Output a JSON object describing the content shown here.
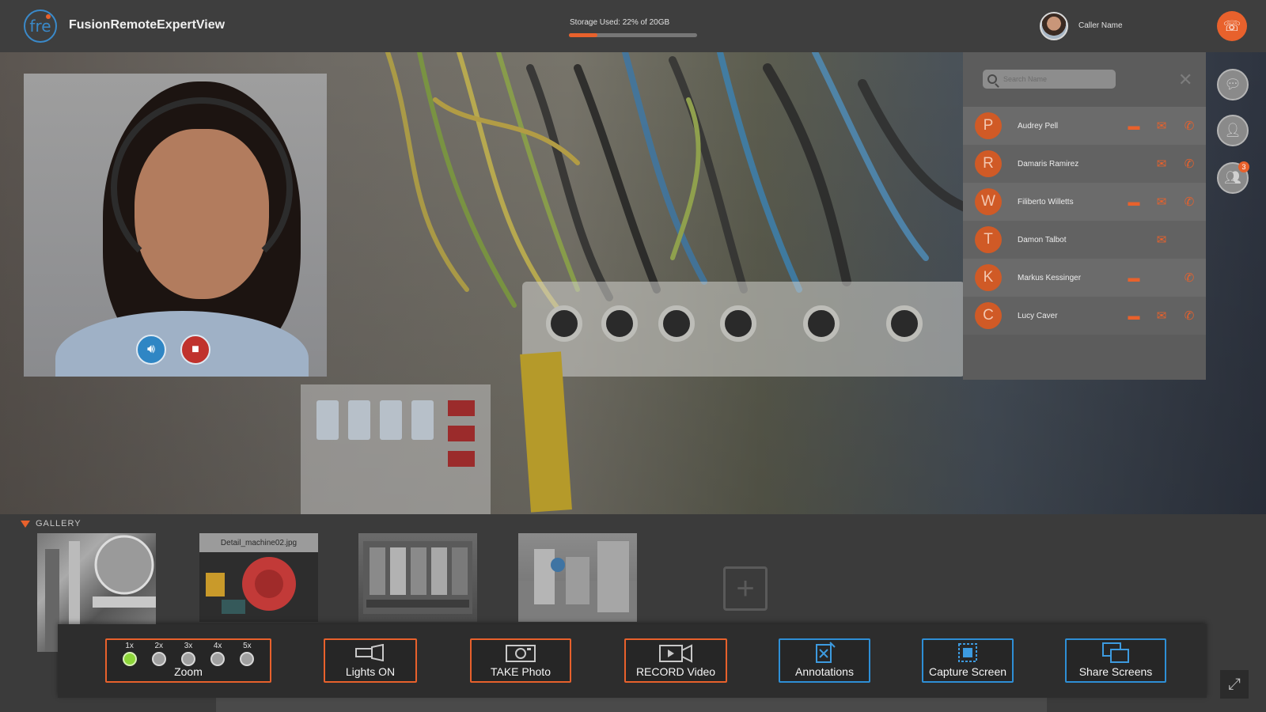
{
  "header": {
    "app_title": "FusionRemoteExpertView",
    "logo_text": "fre",
    "storage_label": "Storage Used: 22% of 20GB",
    "storage_fraction": 0.22,
    "caller_name": "Caller Name",
    "end_call_icon": "phone-hangup-icon"
  },
  "self_view": {
    "audio_icon": "speaker-icon",
    "video_icon": "video-off-icon"
  },
  "contacts": {
    "search_placeholder": "Search Name",
    "close_glyph": "✕",
    "items": [
      {
        "initial": "P",
        "name": "Audrey Pell",
        "chat": true,
        "email": true,
        "call": true
      },
      {
        "initial": "R",
        "name": "Damaris Ramirez",
        "chat": false,
        "email": true,
        "call": true
      },
      {
        "initial": "W",
        "name": "Filiberto Willetts",
        "chat": true,
        "email": true,
        "call": true
      },
      {
        "initial": "T",
        "name": "Damon Talbot",
        "chat": false,
        "email": true,
        "call": false
      },
      {
        "initial": "K",
        "name": "Markus Kessinger",
        "chat": true,
        "email": false,
        "call": true
      },
      {
        "initial": "C",
        "name": "Lucy Caver",
        "chat": true,
        "email": true,
        "call": true
      }
    ]
  },
  "rail": {
    "chat_icon": "chat-bubble-icon",
    "add_user_icon": "add-user-icon",
    "participants_icon": "participants-icon",
    "participants_badge": "3"
  },
  "gallery": {
    "title": "GALLERY",
    "thumbs": [
      {
        "caption": ""
      },
      {
        "caption": "Detail_machine02.jpg"
      },
      {
        "caption": ""
      },
      {
        "caption": ""
      }
    ],
    "add_glyph": "+"
  },
  "controls": {
    "zoom": {
      "label": "Zoom",
      "steps": [
        "1x",
        "2x",
        "3x",
        "4x",
        "5x"
      ],
      "active_index": 0
    },
    "lights_label": "Lights ON",
    "photo_label": "TAKE Photo",
    "record_label": "RECORD Video",
    "annotations_label": "Annotations",
    "capture_label": "Capture Screen",
    "share_label": "Share Screens"
  },
  "colors": {
    "accent": "#e8612c",
    "blue": "#2e8fd6",
    "active_zoom": "#8dd63a"
  }
}
